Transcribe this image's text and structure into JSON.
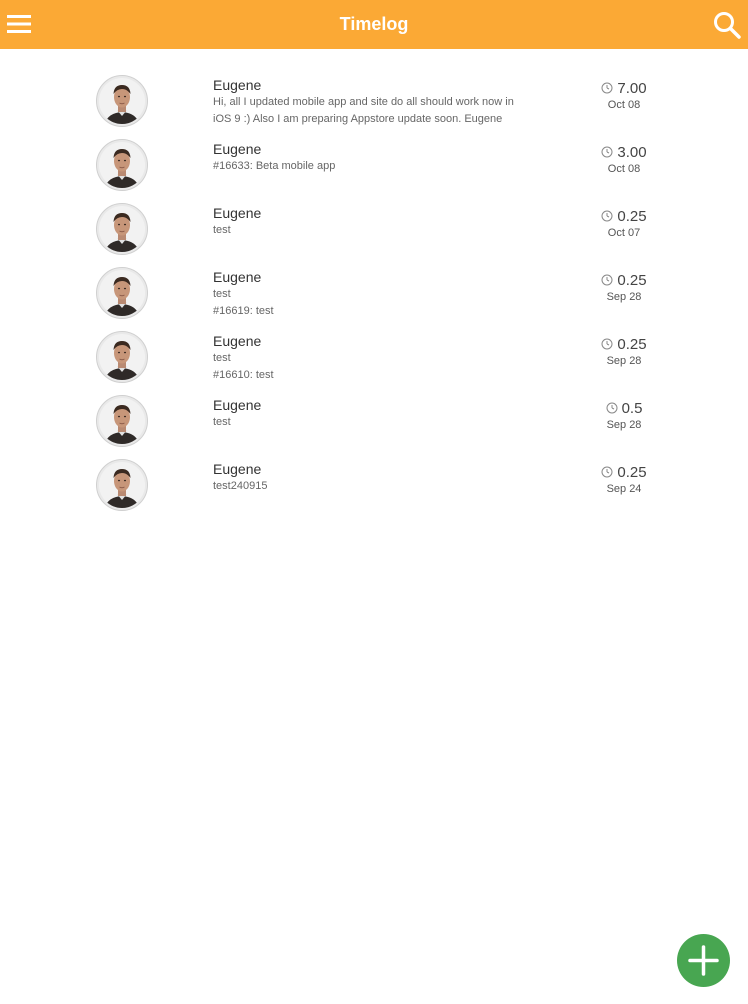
{
  "header": {
    "title": "Timelog",
    "menu_icon": "menu-icon",
    "search_icon": "search-icon",
    "background_color": "#FBA935"
  },
  "entries": [
    {
      "user": "Eugene",
      "lines": [
        "Hi, all I updated mobile app and site do all should work now in",
        "iOS 9 :) Also I am preparing Appstore update soon. Eugene"
      ],
      "duration": "7.00",
      "date": "Oct 08"
    },
    {
      "user": "Eugene",
      "lines": [
        "#16633: Beta mobile app"
      ],
      "duration": "3.00",
      "date": "Oct 08"
    },
    {
      "user": "Eugene",
      "lines": [
        "test"
      ],
      "duration": "0.25",
      "date": "Oct 07"
    },
    {
      "user": "Eugene",
      "lines": [
        "test",
        "#16619: test"
      ],
      "duration": "0.25",
      "date": "Sep 28"
    },
    {
      "user": "Eugene",
      "lines": [
        "test",
        "#16610: test"
      ],
      "duration": "0.25",
      "date": "Sep 28"
    },
    {
      "user": "Eugene",
      "lines": [
        "test"
      ],
      "duration": "0.5",
      "date": "Sep 28"
    },
    {
      "user": "Eugene",
      "lines": [
        "test240915"
      ],
      "duration": "0.25",
      "date": "Sep 24"
    }
  ],
  "fab": {
    "icon": "plus-icon",
    "color": "#48A651"
  }
}
